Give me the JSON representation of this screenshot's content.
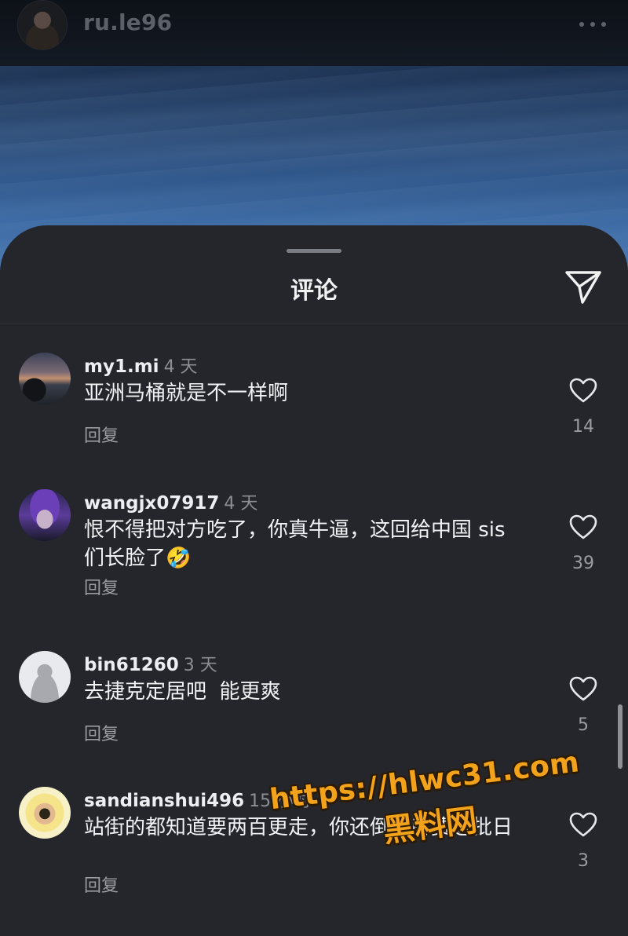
{
  "header": {
    "username": "ru.le96",
    "more_icon": "more-horizontal-icon"
  },
  "sheet": {
    "title": "评论",
    "share_icon": "send-icon"
  },
  "comments": [
    {
      "username": "my1.mi",
      "time": "4 天",
      "text": "亚洲马桶就是不一样啊",
      "reply": "回复",
      "likes": "14"
    },
    {
      "username": "wangjx07917",
      "time": "4 天",
      "text": "恨不得把对方吃了，你真牛逼，这回给中国 sis 们长脸了🤣",
      "reply": "回复",
      "likes": "39"
    },
    {
      "username": "bin61260",
      "time": "3 天",
      "text": "去捷克定居吧  能更爽",
      "reply": "回复",
      "likes": "5"
    },
    {
      "username": "sandianshui496",
      "time": "15 小时",
      "text": "站街的都知道要两百更走，你还倒贴房费送批日",
      "reply": "回复",
      "likes": "3"
    }
  ],
  "watermark": {
    "url": "https://hlwc31.com",
    "name": "黑料网"
  },
  "colors": {
    "sheet_bg": "#24262b",
    "text_primary": "#f1f2f4",
    "text_secondary": "#9a9ca3",
    "watermark": "#f2a21b"
  }
}
